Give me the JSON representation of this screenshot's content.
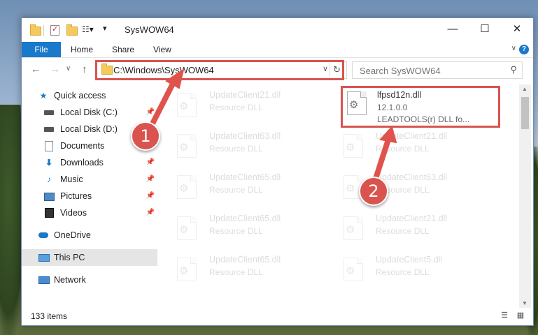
{
  "window": {
    "title": "SysWOW64"
  },
  "ribbon": {
    "tabs": [
      "File",
      "Home",
      "Share",
      "View"
    ],
    "help_label": "?"
  },
  "address": {
    "path": "C:\\Windows\\SysWOW64"
  },
  "search": {
    "placeholder": "Search SysWOW64"
  },
  "sidebar": {
    "items": [
      {
        "label": "Quick access",
        "icon": "star-icon",
        "pinned": false
      },
      {
        "label": "Local Disk (C:)",
        "icon": "drive-icon",
        "pinned": true
      },
      {
        "label": "Local Disk (D:)",
        "icon": "drive-icon",
        "pinned": false
      },
      {
        "label": "Documents",
        "icon": "document-icon",
        "pinned": true
      },
      {
        "label": "Downloads",
        "icon": "download-icon",
        "pinned": true
      },
      {
        "label": "Music",
        "icon": "music-icon",
        "pinned": true
      },
      {
        "label": "Pictures",
        "icon": "picture-icon",
        "pinned": true
      },
      {
        "label": "Videos",
        "icon": "video-icon",
        "pinned": true
      },
      {
        "label": "OneDrive",
        "icon": "cloud-icon",
        "pinned": false
      },
      {
        "label": "This PC",
        "icon": "computer-icon",
        "pinned": false,
        "selected": true
      },
      {
        "label": "Network",
        "icon": "network-icon",
        "pinned": false
      }
    ]
  },
  "files": {
    "highlighted": {
      "name": "lfpsd12n.dll",
      "version": "12.1.0.0",
      "description": "LEADTOOLS(r) DLL fo..."
    },
    "background": [
      {
        "name": "UpdateClient21.dll",
        "type": "Resource DLL"
      },
      {
        "name": "UpdateClient63.dll",
        "type": "Resource DLL"
      },
      {
        "name": "UpdateClient21.dll",
        "type": "Resource DLL"
      },
      {
        "name": "UpdateClient65.dll",
        "type": "Resource DLL"
      },
      {
        "name": "UpdateClient63.dll",
        "type": "Resource DLL"
      },
      {
        "name": "UpdateClient65.dll",
        "type": "Resource DLL"
      },
      {
        "name": "UpdateClient21.dll",
        "type": "Resource DLL"
      },
      {
        "name": "UpdateClient65.dll",
        "type": "Resource DLL"
      },
      {
        "name": "UpdateClient5.dll",
        "type": "Resource DLL"
      }
    ]
  },
  "status": {
    "count": "133 items"
  },
  "annotations": {
    "marker1": "1",
    "marker2": "2",
    "color": "#d9534f"
  },
  "colors": {
    "accent": "#1979ca",
    "highlight": "#d9534f"
  }
}
